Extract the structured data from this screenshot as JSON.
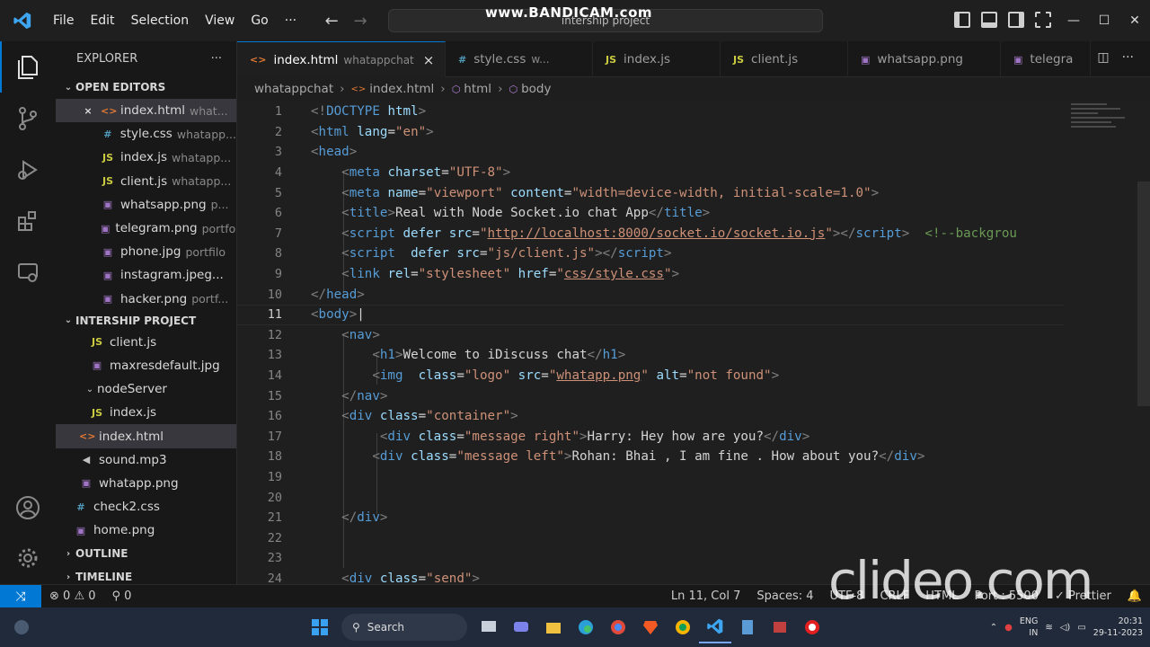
{
  "menu": [
    "File",
    "Edit",
    "Selection",
    "View",
    "Go",
    "···"
  ],
  "command_center": "intership project",
  "watermark_top": "www.BANDICAM.com",
  "watermark_bottom": "clideo.com",
  "sidebar": {
    "title": "EXPLORER",
    "more": "···",
    "open_editors_title": "OPEN EDITORS",
    "open_editors": [
      {
        "icon": "<>",
        "label": "index.html",
        "desc": "what...",
        "type": "html",
        "active": true,
        "close": true
      },
      {
        "icon": "#",
        "label": "style.css",
        "desc": "whatapp...",
        "type": "css"
      },
      {
        "icon": "JS",
        "label": "index.js",
        "desc": "whatapp...",
        "type": "js"
      },
      {
        "icon": "JS",
        "label": "client.js",
        "desc": "whatapp...",
        "type": "js"
      },
      {
        "icon": "▣",
        "label": "whatsapp.png",
        "desc": "p...",
        "type": "img"
      },
      {
        "icon": "▣",
        "label": "telegram.png",
        "desc": "portfolio",
        "type": "img"
      },
      {
        "icon": "▣",
        "label": "phone.jpg",
        "desc": "portfilo",
        "type": "img"
      },
      {
        "icon": "▣",
        "label": "instagram.jpeg...",
        "desc": "",
        "type": "img"
      },
      {
        "icon": "▣",
        "label": "hacker.png",
        "desc": "portf...",
        "type": "img"
      }
    ],
    "project_title": "INTERSHIP PROJECT",
    "project_items": [
      {
        "icon": "JS",
        "label": "client.js",
        "type": "js",
        "indent": 38
      },
      {
        "icon": "▣",
        "label": "maxresdefault.jpg",
        "type": "img",
        "indent": 38
      },
      {
        "icon": "",
        "label": "nodeServer",
        "type": "folder",
        "indent": 30,
        "chev": "⌄"
      },
      {
        "icon": "JS",
        "label": "index.js",
        "type": "js",
        "indent": 38
      },
      {
        "icon": "<>",
        "label": "index.html",
        "type": "html",
        "indent": 26,
        "active": true
      },
      {
        "icon": "◀",
        "label": "sound.mp3",
        "type": "audio",
        "indent": 26
      },
      {
        "icon": "▣",
        "label": "whatapp.png",
        "type": "img",
        "indent": 26
      },
      {
        "icon": "#",
        "label": "check2.css",
        "type": "css",
        "indent": 20
      },
      {
        "icon": "",
        "label": "home.png",
        "type": "img",
        "indent": 20
      }
    ],
    "outline": "OUTLINE",
    "timeline": "TIMELINE"
  },
  "tabs": [
    {
      "icon": "<>",
      "label": "index.html",
      "desc": "whatappchat",
      "type": "html",
      "active": true,
      "close": "×"
    },
    {
      "icon": "#",
      "label": "style.css",
      "desc": "w...",
      "type": "css"
    },
    {
      "icon": "JS",
      "label": "index.js",
      "desc": "",
      "type": "js"
    },
    {
      "icon": "JS",
      "label": "client.js",
      "desc": "",
      "type": "js"
    },
    {
      "icon": "▣",
      "label": "whatsapp.png",
      "desc": "",
      "type": "img"
    },
    {
      "icon": "▣",
      "label": "telegra",
      "desc": "",
      "type": "img"
    }
  ],
  "breadcrumb": [
    "whatappchat",
    "index.html",
    "html",
    "body"
  ],
  "code_lines": [
    {
      "n": "1",
      "html": "<span class='tg'>&lt;!</span><span class='tn'>DOCTYPE</span> <span class='an'>html</span><span class='tg'>&gt;</span>"
    },
    {
      "n": "2",
      "html": "<span class='tg'>&lt;</span><span class='tn'>html</span> <span class='an'>lang</span><span class='tx'>=</span><span class='av'>\"en\"</span><span class='tg'>&gt;</span>"
    },
    {
      "n": "3",
      "html": "<span class='tg'>&lt;</span><span class='tn'>head</span><span class='tg'>&gt;</span>"
    },
    {
      "n": "4",
      "html": "    <span class='tg'>&lt;</span><span class='tn'>meta</span> <span class='an'>charset</span><span class='tx'>=</span><span class='av'>\"UTF-8\"</span><span class='tg'>&gt;</span>"
    },
    {
      "n": "5",
      "html": "    <span class='tg'>&lt;</span><span class='tn'>meta</span> <span class='an'>name</span><span class='tx'>=</span><span class='av'>\"viewport\"</span> <span class='an'>content</span><span class='tx'>=</span><span class='av'>\"width=device-width, initial-scale=1.0\"</span><span class='tg'>&gt;</span>"
    },
    {
      "n": "6",
      "html": "    <span class='tg'>&lt;</span><span class='tn'>title</span><span class='tg'>&gt;</span><span class='tx'>Real with Node Socket.io chat App</span><span class='tg'>&lt;/</span><span class='tn'>title</span><span class='tg'>&gt;</span>"
    },
    {
      "n": "7",
      "html": "    <span class='tg'>&lt;</span><span class='tn'>script</span> <span class='an'>defer</span> <span class='an'>src</span><span class='tx'>=</span><span class='av'>\"<span class='ul'>http://localhost:8000/socket.io/socket.io.js</span>\"</span><span class='tg'>&gt;&lt;/</span><span class='tn'>script</span><span class='tg'>&gt;</span>  <span class='cm'>&lt;!--backgrou</span>"
    },
    {
      "n": "8",
      "html": "    <span class='tg'>&lt;</span><span class='tn'>script</span>  <span class='an'>defer</span> <span class='an'>src</span><span class='tx'>=</span><span class='av'>\"js/client.js\"</span><span class='tg'>&gt;&lt;/</span><span class='tn'>script</span><span class='tg'>&gt;</span>"
    },
    {
      "n": "9",
      "html": "    <span class='tg'>&lt;</span><span class='tn'>link</span> <span class='an'>rel</span><span class='tx'>=</span><span class='av'>\"stylesheet\"</span> <span class='an'>href</span><span class='tx'>=</span><span class='av'>\"<span class='ul'>css/style.css</span>\"</span><span class='tg'>&gt;</span>"
    },
    {
      "n": "10",
      "html": "<span class='tg'>&lt;/</span><span class='tn'>head</span><span class='tg'>&gt;</span>"
    },
    {
      "n": "11",
      "html": "<span class='tg'>&lt;</span><span class='tn'>body</span><span class='tg'>&gt;</span><span class='tx'>|</span>",
      "current": true
    },
    {
      "n": "12",
      "html": "    <span class='tg'>&lt;</span><span class='tn'>nav</span><span class='tg'>&gt;</span>"
    },
    {
      "n": "13",
      "html": "        <span class='tg'>&lt;</span><span class='tn'>h1</span><span class='tg'>&gt;</span><span class='tx'>Welcome to iDiscuss chat</span><span class='tg'>&lt;/</span><span class='tn'>h1</span><span class='tg'>&gt;</span>"
    },
    {
      "n": "14",
      "html": "        <span class='tg'>&lt;</span><span class='tn'>img</span>  <span class='an'>class</span><span class='tx'>=</span><span class='av'>\"logo\"</span> <span class='an'>src</span><span class='tx'>=</span><span class='av'>\"<span class='ul'>whatapp.png</span>\"</span> <span class='an'>alt</span><span class='tx'>=</span><span class='av'>\"not found\"</span><span class='tg'>&gt;</span>"
    },
    {
      "n": "15",
      "html": "    <span class='tg'>&lt;/</span><span class='tn'>nav</span><span class='tg'>&gt;</span>"
    },
    {
      "n": "16",
      "html": "    <span class='tg'>&lt;</span><span class='tn'>div</span> <span class='an'>class</span><span class='tx'>=</span><span class='av'>\"container\"</span><span class='tg'>&gt;</span>"
    },
    {
      "n": "17",
      "html": "         <span class='tg'>&lt;</span><span class='tn'>div</span> <span class='an'>class</span><span class='tx'>=</span><span class='av'>\"message right\"</span><span class='tg'>&gt;</span><span class='tx'>Harry: Hey how are you?</span><span class='tg'>&lt;/</span><span class='tn'>div</span><span class='tg'>&gt;</span>"
    },
    {
      "n": "18",
      "html": "        <span class='tg'>&lt;</span><span class='tn'>div</span> <span class='an'>class</span><span class='tx'>=</span><span class='av'>\"message left\"</span><span class='tg'>&gt;</span><span class='tx'>Rohan: Bhai , I am fine . How about you?</span><span class='tg'>&lt;/</span><span class='tn'>div</span><span class='tg'>&gt;</span>"
    },
    {
      "n": "19",
      "html": ""
    },
    {
      "n": "20",
      "html": ""
    },
    {
      "n": "21",
      "html": "    <span class='tg'>&lt;/</span><span class='tn'>div</span><span class='tg'>&gt;</span>"
    },
    {
      "n": "22",
      "html": ""
    },
    {
      "n": "23",
      "html": ""
    },
    {
      "n": "24",
      "html": "    <span class='tg'>&lt;</span><span class='tn'>div</span> <span class='an'>class</span><span class='tx'>=</span><span class='av'>\"send\"</span><span class='tg'>&gt;</span>"
    }
  ],
  "status": {
    "errors": "⊗ 0",
    "warnings": "⚠ 0",
    "ports": "⚲ 0",
    "position": "Ln 11, Col 7",
    "spaces": "Spaces: 4",
    "encoding": "UTF-8",
    "eol": "CRLF",
    "language": "HTML",
    "port": "Port : 5500",
    "prettier": "✓ Prettier",
    "bell": "🔔"
  },
  "taskbar": {
    "search": "Search",
    "lang1": "ENG",
    "lang2": "IN",
    "time": "20:31",
    "date": "29-11-2023"
  },
  "colors": {
    "accent": "#0078d4",
    "editor_bg": "#1f1f1f",
    "sidebar_bg": "#181818",
    "tag_name": "#569cd6",
    "attr_name": "#9cdcfe",
    "attr_value": "#ce9178"
  }
}
